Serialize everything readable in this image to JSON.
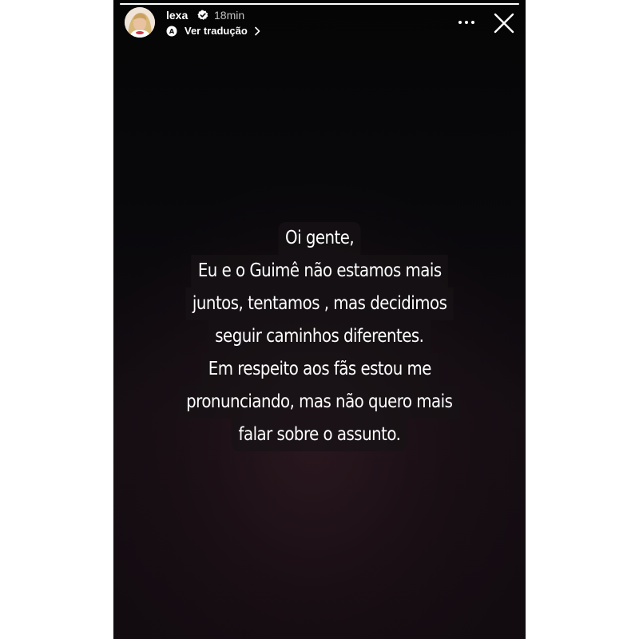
{
  "header": {
    "username": "lexa",
    "time": "18min",
    "translate_label": "Ver tradução"
  },
  "story": {
    "progress": 1.0,
    "text_lines": [
      "Oi gente,",
      "Eu e o Guimê não estamos mais",
      "juntos, tentamos , mas decidimos",
      "seguir caminhos diferentes.",
      "Em respeito aos fãs estou me",
      "pronunciando, mas não quero mais",
      "falar sobre o assunto."
    ]
  },
  "icons": {
    "verified": "verified-badge-icon",
    "translate": "translate-icon",
    "chevron": "chevron-right-icon",
    "more": "more-icon",
    "close": "close-icon"
  },
  "colors": {
    "background": "#0a090c",
    "text": "#ffffff",
    "text_highlight": "#161215"
  }
}
